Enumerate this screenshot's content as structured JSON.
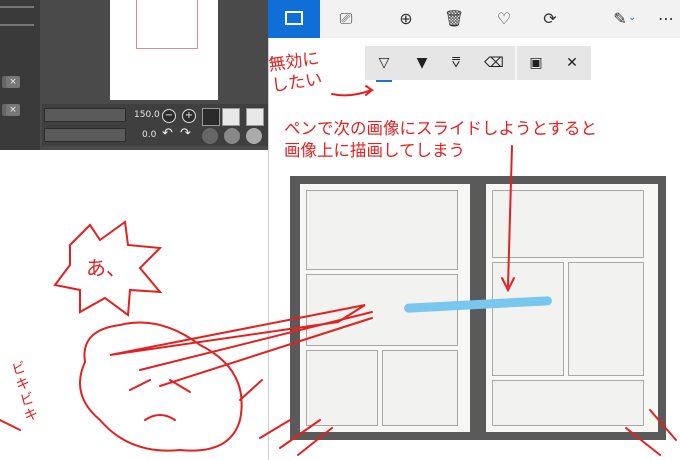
{
  "left_panel": {
    "size_value": "150.0",
    "angle_value": "0.0",
    "minus_symbol": "−",
    "plus_symbol": "+",
    "close_symbol": "×"
  },
  "viewer": {
    "toolbar_icons": [
      "picture-icon",
      "slideshow-icon",
      "zoom-in-icon",
      "delete-icon",
      "favorite-icon",
      "rotate-icon",
      "edit-icon",
      "more-icon"
    ],
    "more_label": "⋯",
    "pen_tools": [
      "ballpoint-pen-icon",
      "pencil-icon",
      "calligraphy-pen-icon",
      "eraser-icon",
      "save-icon",
      "close-icon"
    ]
  },
  "annotations": {
    "disable": "無効に\nしたい",
    "explain_line1": "ペンで次の画像にスライドしようとすると",
    "explain_line2": "画像上に描画してしまう",
    "exclaim": "あ、",
    "onomatopoeia": "ビキビキ"
  },
  "colors": {
    "accent_blue": "#0f6fd6",
    "annotation_red": "#e52020",
    "stroke_blue": "#79c6ef"
  }
}
